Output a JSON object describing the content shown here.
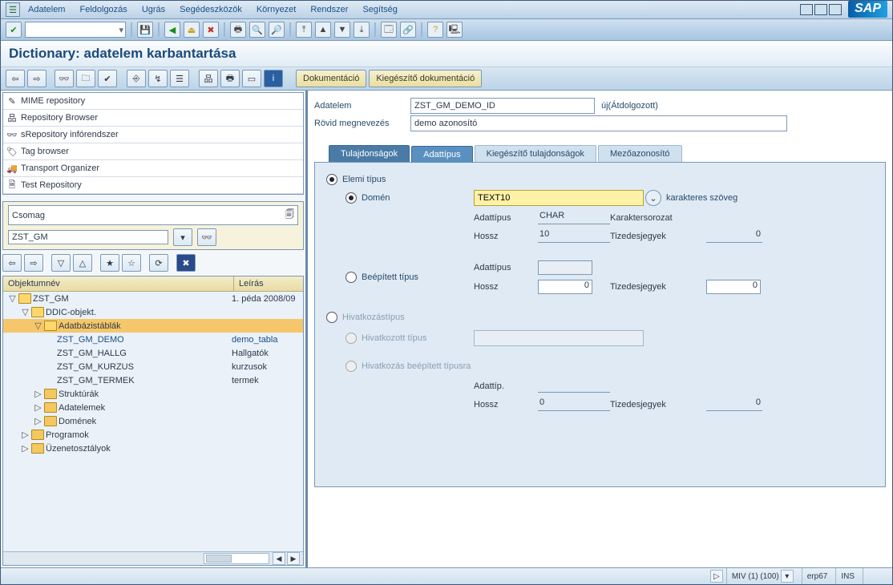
{
  "menubar": {
    "items": [
      "Adatelem",
      "Feldolgozás",
      "Ugrás",
      "Segédeszközök",
      "Környezet",
      "Rendszer",
      "Segítség"
    ]
  },
  "title": "Dictionary: adatelem karbantartása",
  "apptoolbar": {
    "buttons": [
      "Dokumentáció",
      "Kiegészítő dokumentáció"
    ]
  },
  "nav": {
    "items": [
      "MIME repository",
      "Repository Browser",
      "sRepository infórendszer",
      "Tag browser",
      "Transport Organizer",
      "Test Repository"
    ]
  },
  "pkg": {
    "category_label": "Csomag",
    "value": "ZST_GM"
  },
  "tree": {
    "head": {
      "col1": "Objektumnév",
      "col2": "Leírás"
    },
    "rows": [
      {
        "depth": 0,
        "tw": "▽",
        "open": true,
        "label": "ZST_GM",
        "desc": "1. péda 2008/09",
        "cls": ""
      },
      {
        "depth": 1,
        "tw": "▽",
        "open": true,
        "label": "DDIC-objekt.",
        "desc": "",
        "cls": ""
      },
      {
        "depth": 2,
        "tw": "▽",
        "open": true,
        "label": "Adatbázistáblák",
        "desc": "",
        "cls": "sel"
      },
      {
        "depth": 3,
        "tw": "",
        "open": false,
        "label": "ZST_GM_DEMO",
        "desc": "demo_tabla",
        "cls": "link"
      },
      {
        "depth": 3,
        "tw": "",
        "open": false,
        "label": "ZST_GM_HALLG",
        "desc": "Hallgatók",
        "cls": ""
      },
      {
        "depth": 3,
        "tw": "",
        "open": false,
        "label": "ZST_GM_KURZUS",
        "desc": "kurzusok",
        "cls": ""
      },
      {
        "depth": 3,
        "tw": "",
        "open": false,
        "label": "ZST_GM_TERMEK",
        "desc": "termek",
        "cls": ""
      },
      {
        "depth": 2,
        "tw": "▷",
        "open": false,
        "label": "Struktúrák",
        "desc": "",
        "cls": ""
      },
      {
        "depth": 2,
        "tw": "▷",
        "open": false,
        "label": "Adatelemek",
        "desc": "",
        "cls": ""
      },
      {
        "depth": 2,
        "tw": "▷",
        "open": false,
        "label": "Domének",
        "desc": "",
        "cls": ""
      },
      {
        "depth": 1,
        "tw": "▷",
        "open": false,
        "label": "Programok",
        "desc": "",
        "cls": ""
      },
      {
        "depth": 1,
        "tw": "▷",
        "open": false,
        "label": "Üzenetosztályok",
        "desc": "",
        "cls": ""
      }
    ]
  },
  "form": {
    "name_label": "Adatelem",
    "name_value": "ZST_GM_DEMO_ID",
    "name_status": "új(Átdolgozott)",
    "short_label": "Rövid megnevezés",
    "short_value": "demo azonosító"
  },
  "tabs": [
    "Tulajdonságok",
    "Adattípus",
    "Kiegészítő tulajdonságok",
    "Mezőazonosító"
  ],
  "type_tab": {
    "grp_elemi": "Elemi típus",
    "radio_domain": "Domén",
    "domain_value": "TEXT10",
    "domain_extra": "karakteres szöveg",
    "dt_label": "Adattípus",
    "dt_value": "CHAR",
    "dt_text": "Karaktersorozat",
    "len_label": "Hossz",
    "len_value": "10",
    "dec_label": "Tizedesjegyek",
    "dec_value": "0",
    "radio_builtin": "Beépített típus",
    "bi_dt_label": "Adattípus",
    "bi_len_label": "Hossz",
    "bi_len_value": "0",
    "bi_dec_label": "Tizedesjegyek",
    "bi_dec_value": "0",
    "radio_ref": "Hivatkozástípus",
    "radio_ref_name": "Hivatkozott típus",
    "radio_ref_builtin": "Hivatkozás beépített típusra",
    "ref_dt_label": "Adattíp.",
    "ref_len_label": "Hossz",
    "ref_len_value": "0",
    "ref_dec_label": "Tizedesjegyek",
    "ref_dec_value": "0"
  },
  "status": {
    "sys": "MIV (1) (100)",
    "host": "erp67",
    "mode": "INS"
  }
}
